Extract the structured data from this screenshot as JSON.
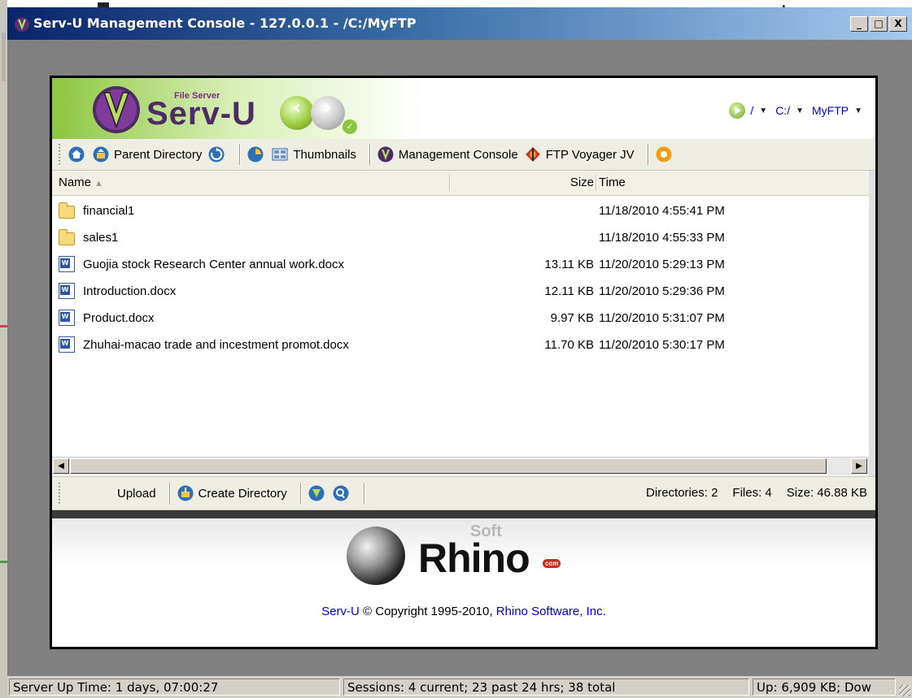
{
  "window": {
    "title": "Serv-U Management Console - 127.0.0.1 - /C:/MyFTP",
    "minimize": "_",
    "maximize": "□",
    "close": "X"
  },
  "header": {
    "logo_small": "File Server",
    "logo_word": "Serv-U",
    "path": [
      {
        "label": "/"
      },
      {
        "label": "C:/"
      },
      {
        "label": "MyFTP"
      }
    ]
  },
  "toolbar": {
    "parent_directory": "Parent Directory",
    "thumbnails": "Thumbnails",
    "management_console": "Management Console",
    "ftp_voyager": "FTP Voyager JV"
  },
  "list": {
    "columns": {
      "name": "Name",
      "size": "Size",
      "time": "Time"
    },
    "rows": [
      {
        "type": "folder",
        "name": "financial1",
        "size": "",
        "time": "11/18/2010 4:55:41 PM"
      },
      {
        "type": "folder",
        "name": "sales1",
        "size": "",
        "time": "11/18/2010 4:55:33 PM"
      },
      {
        "type": "doc",
        "name": "Guojia stock Research Center annual work.docx",
        "size": "13.11 KB",
        "time": "11/20/2010 5:29:13 PM"
      },
      {
        "type": "doc",
        "name": "Introduction.docx",
        "size": "12.11 KB",
        "time": "11/20/2010 5:29:36 PM"
      },
      {
        "type": "doc",
        "name": "Product.docx",
        "size": "9.97 KB",
        "time": "11/20/2010 5:31:07 PM"
      },
      {
        "type": "doc",
        "name": "Zhuhai-macao trade and incestment promot.docx",
        "size": "11.70 KB",
        "time": "11/20/2010 5:30:17 PM"
      }
    ]
  },
  "bottombar": {
    "upload": "Upload",
    "create_directory": "Create Directory",
    "directories": "Directories: 2",
    "files": "Files: 4",
    "size": "Size: 46.88 KB"
  },
  "footer": {
    "rhino_word": "Rhino",
    "rhino_soft": "Soft",
    "rhino_com": "com",
    "serv_u_link": "Serv-U",
    "copyright": " © Copyright 1995-2010, ",
    "rhino_link": "Rhino Software, Inc."
  },
  "statusbar": {
    "uptime": "Server Up Time: 1 days, 07:00:27",
    "sessions": "Sessions: 4 current; 23 past 24 hrs; 38 total",
    "transfer": "Up: 6,909 KB; Dow"
  },
  "colors": {
    "accent_green": "#8cc63f",
    "brand_purple": "#4e2a67",
    "link_blue": "#0000cc",
    "titlebar": "#0a246a"
  }
}
